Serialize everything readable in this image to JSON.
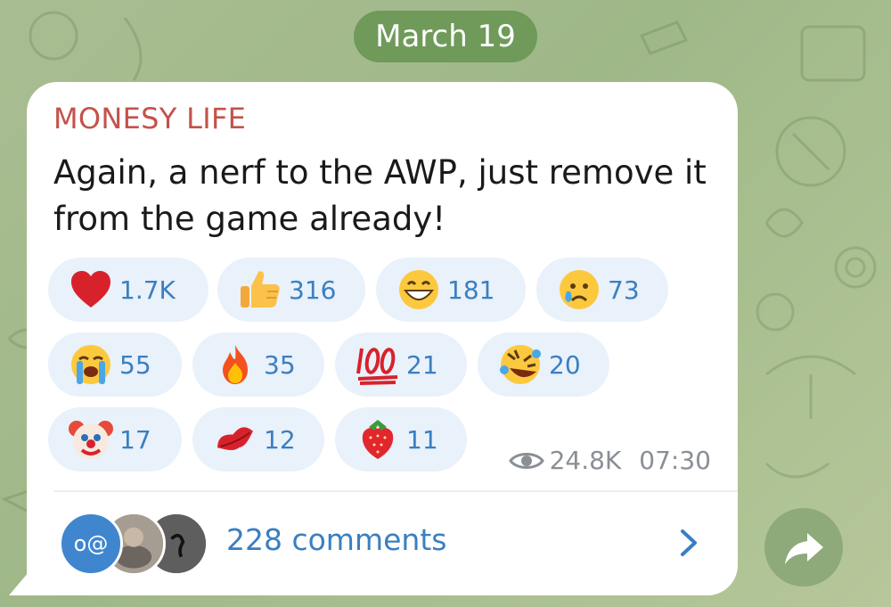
{
  "date": "March 19",
  "post": {
    "channel": "MONESY LIFE",
    "text": "Again, a nerf to the AWP, just remove it from the game already!",
    "views": "24.8K",
    "time": "07:30"
  },
  "reactions": [
    {
      "icon": "red-heart-icon",
      "count": "1.7K"
    },
    {
      "icon": "thumbs-up-icon",
      "count": "316"
    },
    {
      "icon": "grinning-face-icon",
      "count": "181"
    },
    {
      "icon": "crying-face-icon",
      "count": "73"
    },
    {
      "icon": "loudly-crying-face-icon",
      "count": "55"
    },
    {
      "icon": "fire-icon",
      "count": "35"
    },
    {
      "icon": "hundred-points-icon",
      "count": "21"
    },
    {
      "icon": "rolling-laughing-icon",
      "count": "20"
    },
    {
      "icon": "clown-face-icon",
      "count": "17"
    },
    {
      "icon": "kiss-mark-icon",
      "count": "12"
    },
    {
      "icon": "strawberry-icon",
      "count": "11"
    }
  ],
  "comments": {
    "label": "228 comments",
    "avatar_text": "o@"
  },
  "colors": {
    "channel_name": "#c4524b",
    "accent": "#3a7fc1",
    "reaction_bg": "#e9f1fb",
    "date_pill": "#6f9a5a"
  }
}
